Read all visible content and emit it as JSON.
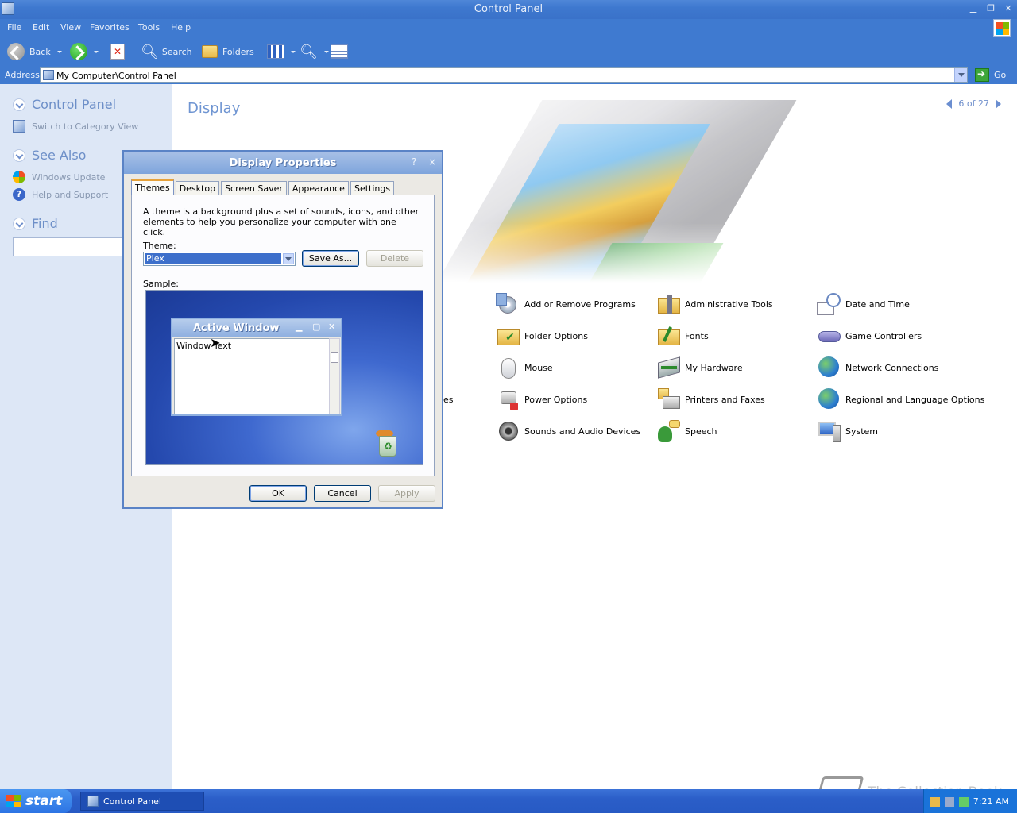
{
  "window": {
    "title": "Control Panel"
  },
  "menu": [
    "File",
    "Edit",
    "View",
    "Favorites",
    "Tools",
    "Help"
  ],
  "toolbar": {
    "back": "Back",
    "search": "Search",
    "folders": "Folders"
  },
  "address": {
    "label": "Address",
    "value": "My Computer\\Control Panel",
    "go": "Go"
  },
  "left_pane": {
    "control_panel": {
      "title": "Control Panel",
      "links": [
        "Switch to Category View"
      ]
    },
    "see_also": {
      "title": "See Also",
      "links": [
        "Windows Update",
        "Help and Support"
      ]
    },
    "find": {
      "title": "Find",
      "value": ""
    }
  },
  "content": {
    "title": "Display",
    "pager": "6 of 27",
    "items": [
      [
        "Add or Remove Programs",
        "Administrative Tools",
        "Date and Time"
      ],
      [
        "Folder Options",
        "Fonts",
        "Game Controllers"
      ],
      [
        "Mouse",
        "My Hardware",
        "Network Connections"
      ],
      [
        "Power Options",
        "Printers and Faxes",
        "Regional and Language Options"
      ],
      [
        "Sounds and Audio Devices",
        "Speech",
        "System"
      ]
    ],
    "partial_item": "es"
  },
  "dialog": {
    "title": "Display Properties",
    "help": "?",
    "close": "×",
    "tabs": [
      "Themes",
      "Desktop",
      "Screen Saver",
      "Appearance",
      "Settings"
    ],
    "active_tab": "Themes",
    "description": "A theme is a background plus a set of sounds, icons, and other elements to help you personalize your computer with one click.",
    "theme_label": "Theme:",
    "theme_value": "Plex",
    "save_as": "Save As...",
    "delete": "Delete",
    "sample_label": "Sample:",
    "sample_window": {
      "title": "Active Window",
      "text": "Window Text"
    },
    "ok": "OK",
    "cancel": "Cancel",
    "apply": "Apply"
  },
  "taskbar": {
    "start": "start",
    "task": "Control Panel",
    "clock": "7:21 AM"
  },
  "watermark": "The Collection Book",
  "colors": {
    "titlebar": "#3e78cf",
    "leftpane": "#dde7f6",
    "accent_link": "#6f95d2",
    "taskbar": "#2b5ec8"
  }
}
